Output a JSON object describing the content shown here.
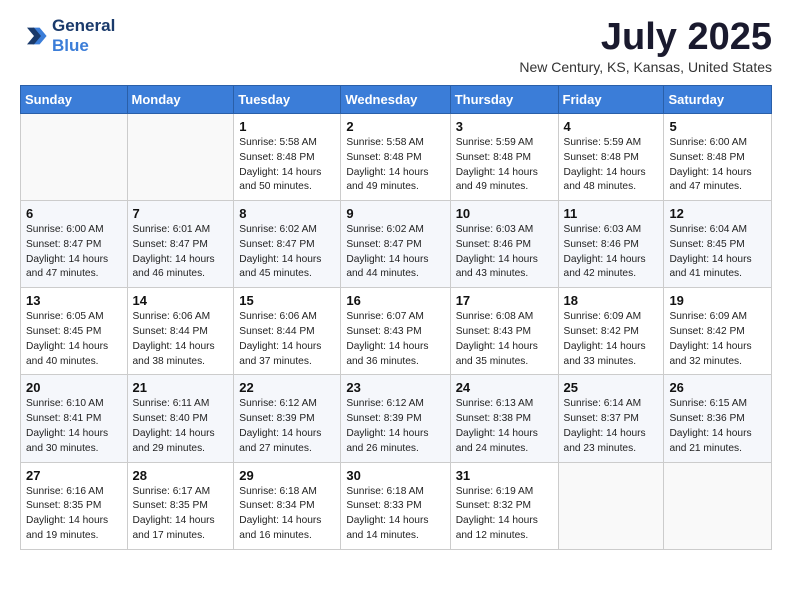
{
  "header": {
    "logo_line1": "General",
    "logo_line2": "Blue",
    "month_title": "July 2025",
    "subtitle": "New Century, KS, Kansas, United States"
  },
  "weekdays": [
    "Sunday",
    "Monday",
    "Tuesday",
    "Wednesday",
    "Thursday",
    "Friday",
    "Saturday"
  ],
  "weeks": [
    [
      {
        "day": "",
        "info": ""
      },
      {
        "day": "",
        "info": ""
      },
      {
        "day": "1",
        "info": "Sunrise: 5:58 AM\nSunset: 8:48 PM\nDaylight: 14 hours and 50 minutes."
      },
      {
        "day": "2",
        "info": "Sunrise: 5:58 AM\nSunset: 8:48 PM\nDaylight: 14 hours and 49 minutes."
      },
      {
        "day": "3",
        "info": "Sunrise: 5:59 AM\nSunset: 8:48 PM\nDaylight: 14 hours and 49 minutes."
      },
      {
        "day": "4",
        "info": "Sunrise: 5:59 AM\nSunset: 8:48 PM\nDaylight: 14 hours and 48 minutes."
      },
      {
        "day": "5",
        "info": "Sunrise: 6:00 AM\nSunset: 8:48 PM\nDaylight: 14 hours and 47 minutes."
      }
    ],
    [
      {
        "day": "6",
        "info": "Sunrise: 6:00 AM\nSunset: 8:47 PM\nDaylight: 14 hours and 47 minutes."
      },
      {
        "day": "7",
        "info": "Sunrise: 6:01 AM\nSunset: 8:47 PM\nDaylight: 14 hours and 46 minutes."
      },
      {
        "day": "8",
        "info": "Sunrise: 6:02 AM\nSunset: 8:47 PM\nDaylight: 14 hours and 45 minutes."
      },
      {
        "day": "9",
        "info": "Sunrise: 6:02 AM\nSunset: 8:47 PM\nDaylight: 14 hours and 44 minutes."
      },
      {
        "day": "10",
        "info": "Sunrise: 6:03 AM\nSunset: 8:46 PM\nDaylight: 14 hours and 43 minutes."
      },
      {
        "day": "11",
        "info": "Sunrise: 6:03 AM\nSunset: 8:46 PM\nDaylight: 14 hours and 42 minutes."
      },
      {
        "day": "12",
        "info": "Sunrise: 6:04 AM\nSunset: 8:45 PM\nDaylight: 14 hours and 41 minutes."
      }
    ],
    [
      {
        "day": "13",
        "info": "Sunrise: 6:05 AM\nSunset: 8:45 PM\nDaylight: 14 hours and 40 minutes."
      },
      {
        "day": "14",
        "info": "Sunrise: 6:06 AM\nSunset: 8:44 PM\nDaylight: 14 hours and 38 minutes."
      },
      {
        "day": "15",
        "info": "Sunrise: 6:06 AM\nSunset: 8:44 PM\nDaylight: 14 hours and 37 minutes."
      },
      {
        "day": "16",
        "info": "Sunrise: 6:07 AM\nSunset: 8:43 PM\nDaylight: 14 hours and 36 minutes."
      },
      {
        "day": "17",
        "info": "Sunrise: 6:08 AM\nSunset: 8:43 PM\nDaylight: 14 hours and 35 minutes."
      },
      {
        "day": "18",
        "info": "Sunrise: 6:09 AM\nSunset: 8:42 PM\nDaylight: 14 hours and 33 minutes."
      },
      {
        "day": "19",
        "info": "Sunrise: 6:09 AM\nSunset: 8:42 PM\nDaylight: 14 hours and 32 minutes."
      }
    ],
    [
      {
        "day": "20",
        "info": "Sunrise: 6:10 AM\nSunset: 8:41 PM\nDaylight: 14 hours and 30 minutes."
      },
      {
        "day": "21",
        "info": "Sunrise: 6:11 AM\nSunset: 8:40 PM\nDaylight: 14 hours and 29 minutes."
      },
      {
        "day": "22",
        "info": "Sunrise: 6:12 AM\nSunset: 8:39 PM\nDaylight: 14 hours and 27 minutes."
      },
      {
        "day": "23",
        "info": "Sunrise: 6:12 AM\nSunset: 8:39 PM\nDaylight: 14 hours and 26 minutes."
      },
      {
        "day": "24",
        "info": "Sunrise: 6:13 AM\nSunset: 8:38 PM\nDaylight: 14 hours and 24 minutes."
      },
      {
        "day": "25",
        "info": "Sunrise: 6:14 AM\nSunset: 8:37 PM\nDaylight: 14 hours and 23 minutes."
      },
      {
        "day": "26",
        "info": "Sunrise: 6:15 AM\nSunset: 8:36 PM\nDaylight: 14 hours and 21 minutes."
      }
    ],
    [
      {
        "day": "27",
        "info": "Sunrise: 6:16 AM\nSunset: 8:35 PM\nDaylight: 14 hours and 19 minutes."
      },
      {
        "day": "28",
        "info": "Sunrise: 6:17 AM\nSunset: 8:35 PM\nDaylight: 14 hours and 17 minutes."
      },
      {
        "day": "29",
        "info": "Sunrise: 6:18 AM\nSunset: 8:34 PM\nDaylight: 14 hours and 16 minutes."
      },
      {
        "day": "30",
        "info": "Sunrise: 6:18 AM\nSunset: 8:33 PM\nDaylight: 14 hours and 14 minutes."
      },
      {
        "day": "31",
        "info": "Sunrise: 6:19 AM\nSunset: 8:32 PM\nDaylight: 14 hours and 12 minutes."
      },
      {
        "day": "",
        "info": ""
      },
      {
        "day": "",
        "info": ""
      }
    ]
  ]
}
